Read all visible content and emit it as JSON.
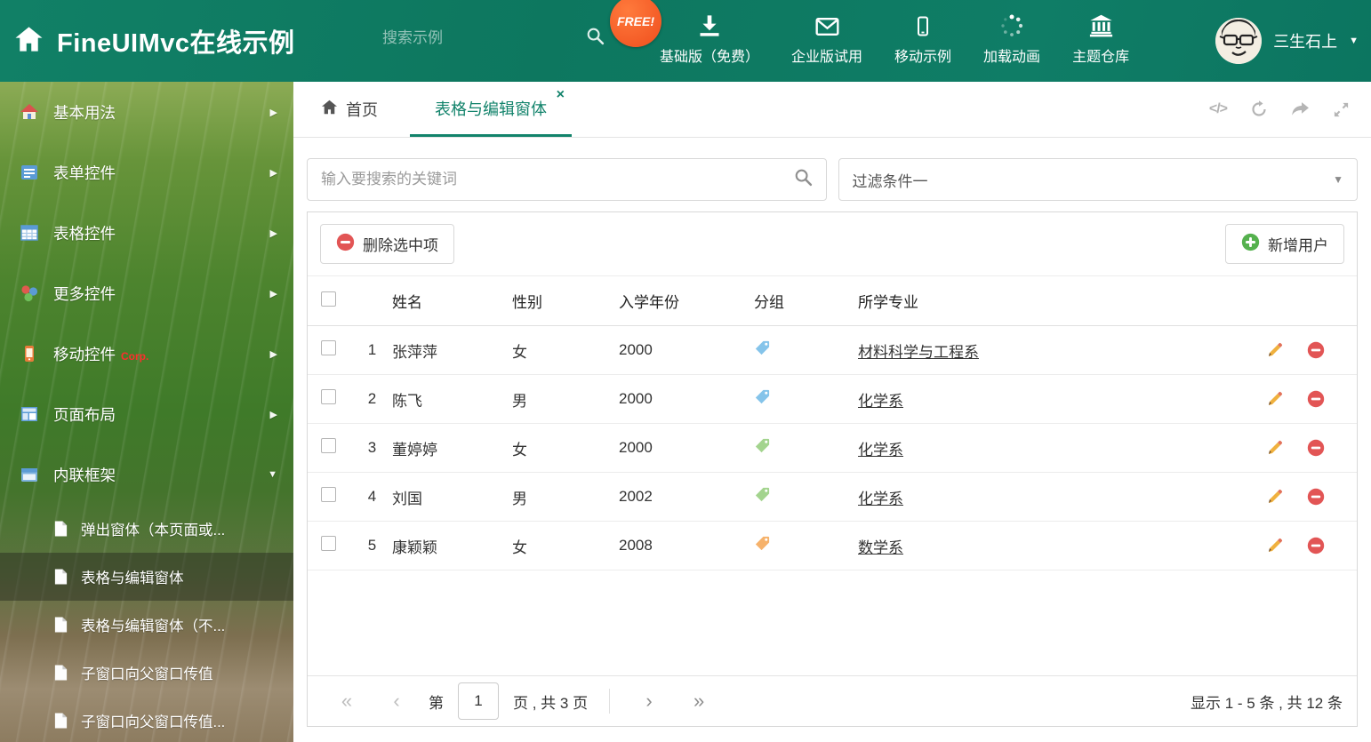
{
  "colors": {
    "accent": "#12836b",
    "danger": "#e25555",
    "success": "#55b14e"
  },
  "header": {
    "title": "FineUIMvc在线示例",
    "search_placeholder": "搜索示例",
    "free_badge": "FREE!",
    "nav": [
      {
        "label": "基础版（免费）",
        "icon": "download-icon"
      },
      {
        "label": "企业版试用",
        "icon": "envelope-icon"
      },
      {
        "label": "移动示例",
        "icon": "mobile-icon"
      },
      {
        "label": "加载动画",
        "icon": "spinner-icon"
      },
      {
        "label": "主题仓库",
        "icon": "bank-icon"
      }
    ],
    "user": {
      "name": "三生石上",
      "caret": "▼"
    }
  },
  "sidebar": {
    "items": [
      {
        "label": "基本用法",
        "arrow": "▶"
      },
      {
        "label": "表单控件",
        "arrow": "▶"
      },
      {
        "label": "表格控件",
        "arrow": "▶"
      },
      {
        "label": "更多控件",
        "arrow": "▶"
      },
      {
        "label": "移动控件",
        "badge": "Corp.",
        "arrow": "▶"
      },
      {
        "label": "页面布局",
        "arrow": "▶"
      },
      {
        "label": "内联框架",
        "arrow": "▼"
      }
    ],
    "subitems": [
      {
        "label": "弹出窗体（本页面或..."
      },
      {
        "label": "表格与编辑窗体"
      },
      {
        "label": "表格与编辑窗体（不..."
      },
      {
        "label": "子窗口向父窗口传值"
      },
      {
        "label": "子窗口向父窗口传值..."
      }
    ]
  },
  "tabs": {
    "home_label": "首页",
    "active_label": "表格与编辑窗体",
    "close_glyph": "×",
    "code_glyph": "</>"
  },
  "filters": {
    "keyword_placeholder": "输入要搜索的关键词",
    "filter_value": "过滤条件一",
    "caret": "▼"
  },
  "toolbar": {
    "delete_button": "删除选中项",
    "add_button": "新增用户"
  },
  "grid": {
    "columns": {
      "name": "姓名",
      "gender": "性别",
      "year": "入学年份",
      "group": "分组",
      "major": "所学专业"
    },
    "rows": [
      {
        "num": "1",
        "name": "张萍萍",
        "gender": "女",
        "year": "2000",
        "tag_color": "#85c4ea",
        "major": "材料科学与工程系"
      },
      {
        "num": "2",
        "name": "陈飞",
        "gender": "男",
        "year": "2000",
        "tag_color": "#85c4ea",
        "major": "化学系"
      },
      {
        "num": "3",
        "name": "董婷婷",
        "gender": "女",
        "year": "2000",
        "tag_color": "#a3d48e",
        "major": "化学系"
      },
      {
        "num": "4",
        "name": "刘国",
        "gender": "男",
        "year": "2002",
        "tag_color": "#a3d48e",
        "major": "化学系"
      },
      {
        "num": "5",
        "name": "康颖颖",
        "gender": "女",
        "year": "2008",
        "tag_color": "#f6b26b",
        "major": "数学系"
      }
    ]
  },
  "pagination": {
    "first": "«",
    "prev": "‹",
    "next": "›",
    "last": "»",
    "page_label_before": "第",
    "current_page": "1",
    "page_label_after": "页 , 共 3 页",
    "summary": "显示 1 - 5 条 , 共 12 条"
  }
}
